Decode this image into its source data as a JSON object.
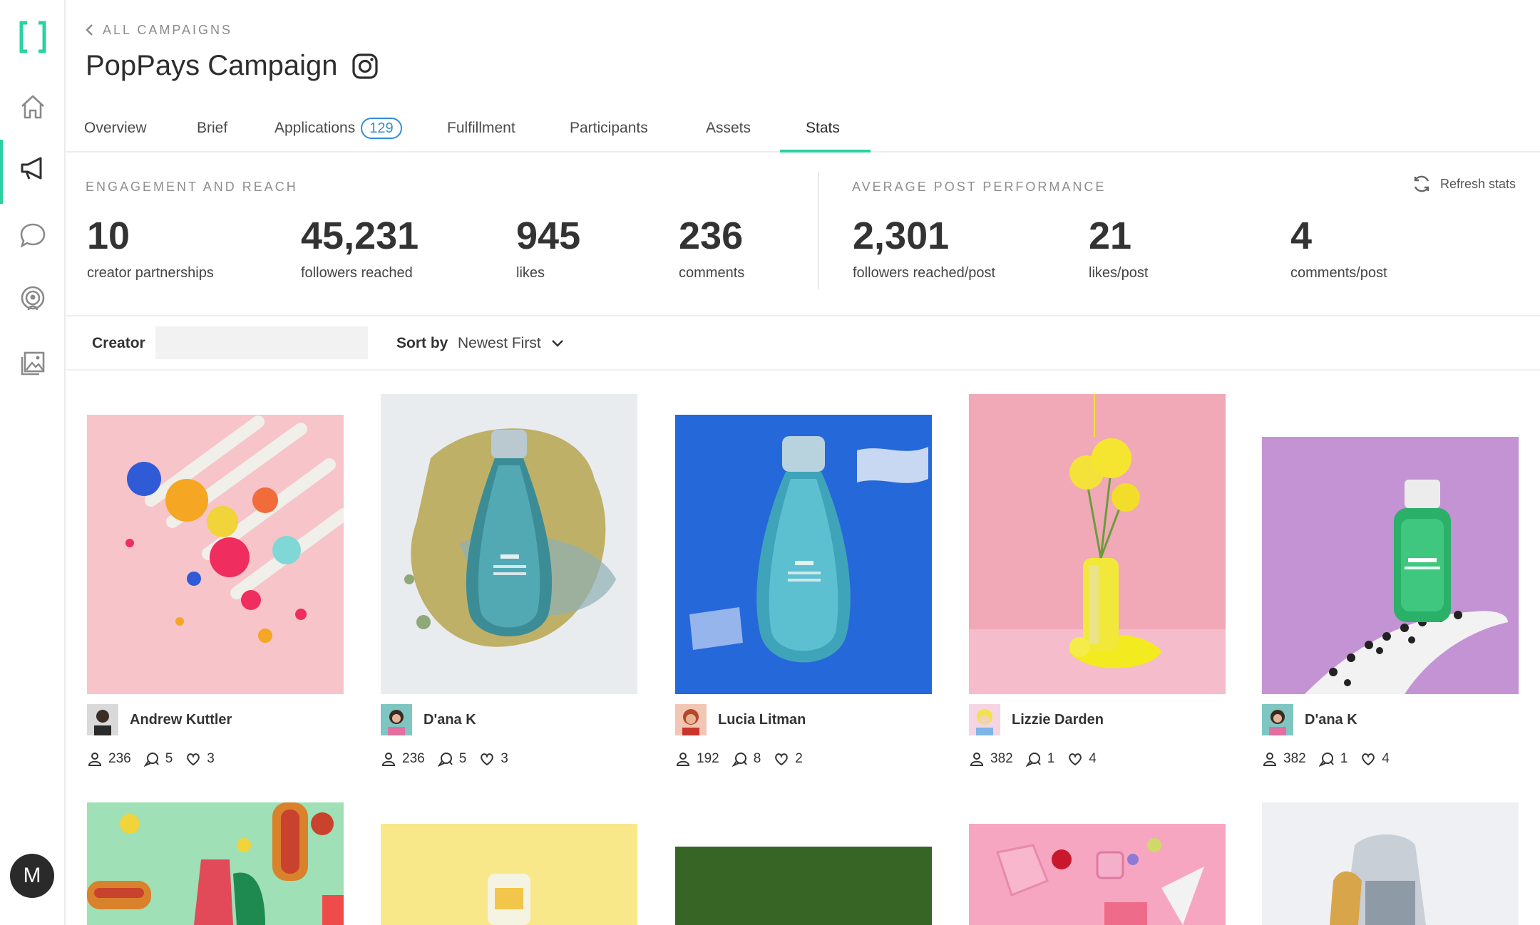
{
  "breadcrumb": {
    "label": "ALL CAMPAIGNS"
  },
  "campaign": {
    "title": "PopPays Campaign",
    "platform_icon": "instagram-icon"
  },
  "tabs": [
    {
      "label": "Overview"
    },
    {
      "label": "Brief"
    },
    {
      "label": "Applications",
      "badge": "129"
    },
    {
      "label": "Fulfillment"
    },
    {
      "label": "Participants"
    },
    {
      "label": "Assets"
    },
    {
      "label": "Stats",
      "active": true
    }
  ],
  "engagement": {
    "heading": "ENGAGEMENT AND REACH",
    "stats": [
      {
        "value": "10",
        "label": "creator partnerships"
      },
      {
        "value": "45,231",
        "label": "followers reached"
      },
      {
        "value": "945",
        "label": "likes"
      },
      {
        "value": "236",
        "label": "comments"
      }
    ]
  },
  "average": {
    "heading": "AVERAGE POST PERFORMANCE",
    "stats": [
      {
        "value": "2,301",
        "label": "followers reached/post"
      },
      {
        "value": "21",
        "label": "likes/post"
      },
      {
        "value": "4",
        "label": "comments/post"
      }
    ],
    "refresh_label": "Refresh stats"
  },
  "filters": {
    "creator_label": "Creator",
    "creator_value": "",
    "sort_label": "Sort by",
    "sort_value": "Newest First"
  },
  "posts": [
    {
      "creator": "Andrew Kuttler",
      "followers": "236",
      "comments": "5",
      "likes": "3"
    },
    {
      "creator": "D'ana K",
      "followers": "236",
      "comments": "5",
      "likes": "3"
    },
    {
      "creator": "Lucia Litman",
      "followers": "192",
      "comments": "8",
      "likes": "2"
    },
    {
      "creator": "Lizzie Darden",
      "followers": "382",
      "comments": "1",
      "likes": "4"
    },
    {
      "creator": "D'ana K",
      "followers": "382",
      "comments": "1",
      "likes": "4"
    }
  ],
  "user": {
    "initial": "M"
  },
  "colors": {
    "accent": "#2bd1a2",
    "badge": "#2f8fd6",
    "text": "#2f2f2f"
  }
}
